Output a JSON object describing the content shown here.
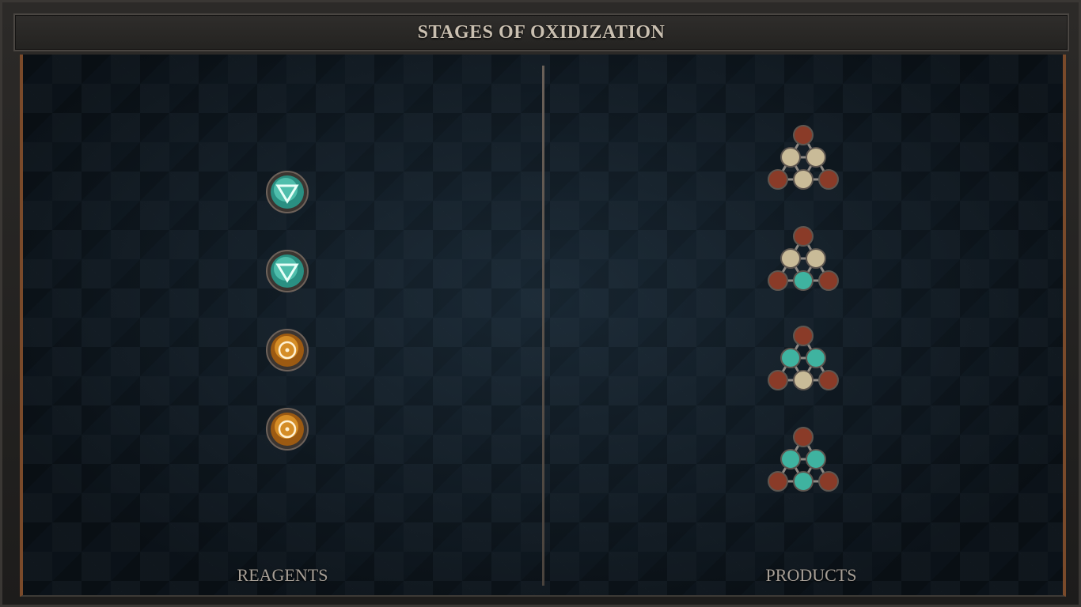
{
  "window": {
    "title": "STAGES OF OXIDIZATION"
  },
  "columns": {
    "left_label": "REAGENTS",
    "right_label": "PRODUCTS"
  },
  "reagents": [
    {
      "element": "water",
      "icon": "water-triangle-icon"
    },
    {
      "element": "water",
      "icon": "water-triangle-icon"
    },
    {
      "element": "gold",
      "icon": "gold-circle-icon"
    },
    {
      "element": "gold",
      "icon": "gold-circle-icon"
    }
  ],
  "products": [
    {
      "icon": "molecule-icon",
      "stage": 1
    },
    {
      "icon": "molecule-icon",
      "stage": 2
    },
    {
      "icon": "molecule-icon",
      "stage": 3
    },
    {
      "icon": "molecule-icon",
      "stage": 4
    }
  ],
  "colors": {
    "water": "#3fb3a0",
    "gold": "#c7801c",
    "copper": "#8a3b28",
    "salt": "#c9bb98",
    "frame_accent": "#7a4a2a",
    "title_text": "#c9bfb0"
  }
}
